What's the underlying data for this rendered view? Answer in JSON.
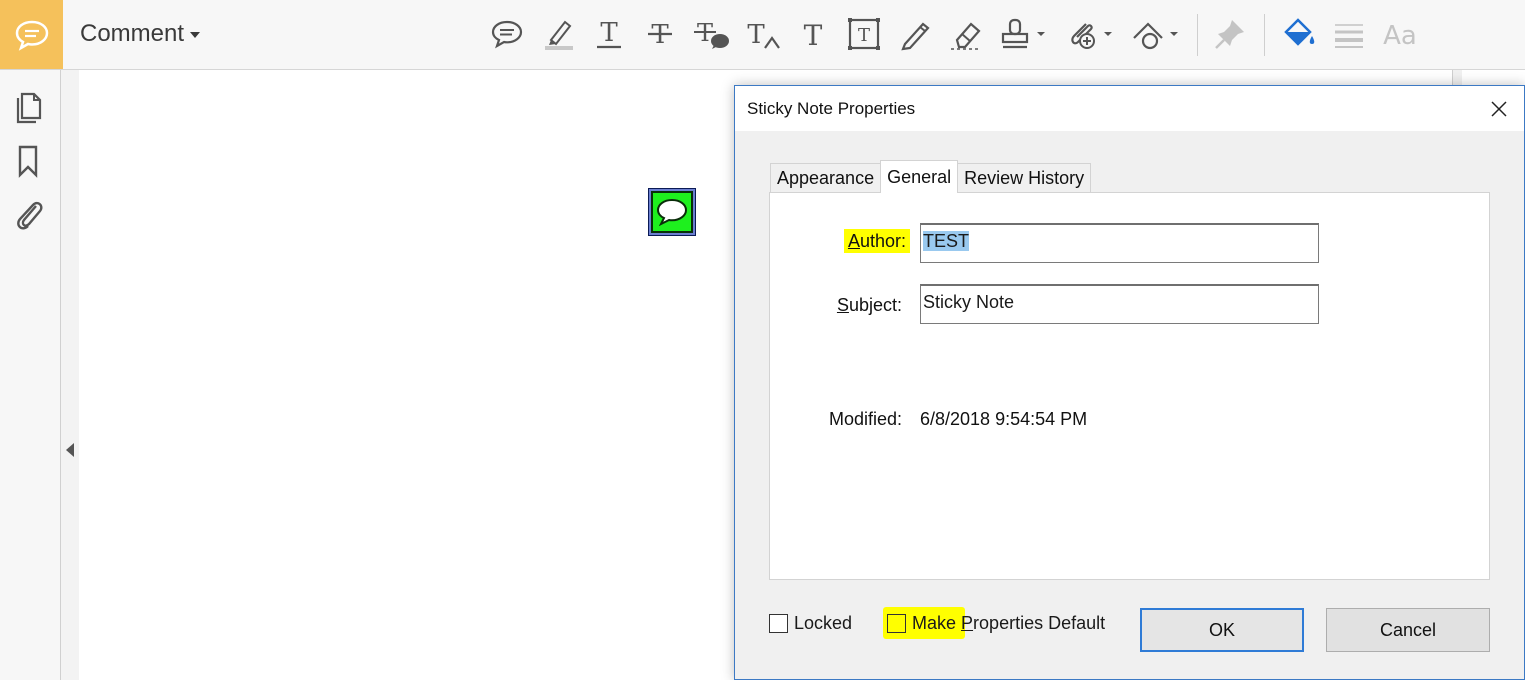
{
  "toolbar": {
    "title": "Comment",
    "icons": [
      "sticky-note-icon",
      "highlight-icon",
      "underline-text-icon",
      "strikethrough-icon",
      "replace-text-icon",
      "insert-text-icon",
      "add-text-icon",
      "textbox-icon",
      "pencil-icon",
      "eraser-icon",
      "stamp-icon",
      "attach-file-icon",
      "drawing-tools-icon",
      "pin-icon",
      "fill-color-icon",
      "line-properties-icon",
      "text-properties-icon"
    ],
    "accent": "#f5c15b",
    "fill_color": "#1f6fd1"
  },
  "left_rail": {
    "icons": [
      "pages-icon",
      "bookmark-icon",
      "attachment-icon"
    ]
  },
  "document": {
    "sticky_note_color": "#1ef01e"
  },
  "dialog": {
    "title": "Sticky Note Properties",
    "tabs": [
      "Appearance",
      "General",
      "Review History"
    ],
    "active_tab": "General",
    "fields": {
      "author_label_u": "A",
      "author_label_rest": "uthor:",
      "author_value": "TEST",
      "subject_label_u": "S",
      "subject_label_rest": "ubject:",
      "subject_value": "Sticky Note",
      "modified_label": "Modified:",
      "modified_value": "6/8/2018 9:54:54 PM"
    },
    "locked_label": "Locked",
    "locked_checked": false,
    "make_default_u_pre": "Make ",
    "make_default_u": "P",
    "make_default_rest": "roperties Default",
    "make_default_checked": false,
    "ok_label": "OK",
    "cancel_label": "Cancel",
    "highlight_color": "#ffff00"
  }
}
